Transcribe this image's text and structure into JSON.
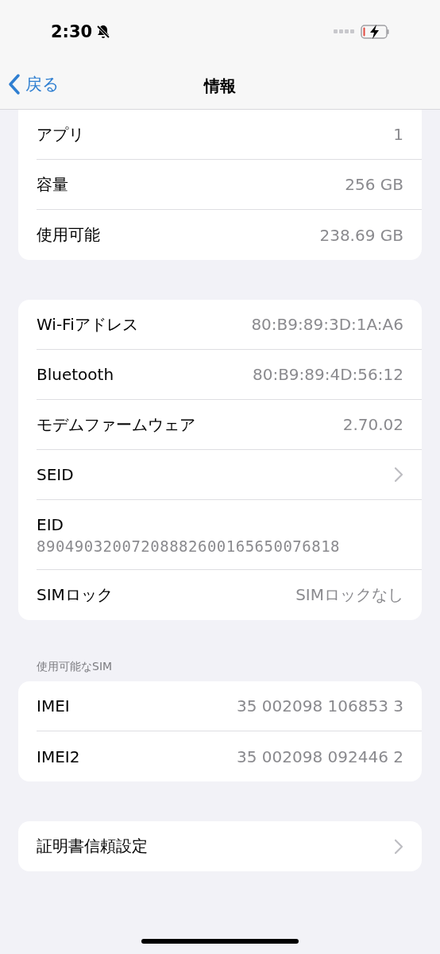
{
  "status_bar": {
    "time": "2:30",
    "silent": true,
    "charging": true
  },
  "nav": {
    "back": "戻る",
    "title": "情報"
  },
  "groups": [
    {
      "rows": [
        {
          "kind": "value",
          "label": "アプリ",
          "value": "1"
        },
        {
          "kind": "value",
          "label": "容量",
          "value": "256 GB"
        },
        {
          "kind": "value",
          "label": "使用可能",
          "value": "238.69 GB"
        }
      ]
    },
    {
      "rows": [
        {
          "kind": "value",
          "label": "Wi-Fiアドレス",
          "value": "80:B9:89:3D:1A:A6"
        },
        {
          "kind": "value",
          "label": "Bluetooth",
          "value": "80:B9:89:4D:56:12"
        },
        {
          "kind": "value",
          "label": "モデムファームウェア",
          "value": "2.70.02"
        },
        {
          "kind": "chevron",
          "label": "SEID"
        },
        {
          "kind": "stacked",
          "label": "EID",
          "value": "89049032007208882600165650076818"
        },
        {
          "kind": "value",
          "label": "SIMロック",
          "value": "SIMロックなし"
        }
      ]
    },
    {
      "header": "使用可能なSIM",
      "rows": [
        {
          "kind": "value",
          "label": "IMEI",
          "value": "35 002098 106853 3"
        },
        {
          "kind": "value",
          "label": "IMEI2",
          "value": "35 002098 092446 2"
        }
      ]
    },
    {
      "rows": [
        {
          "kind": "chevron",
          "label": "証明書信頼設定"
        }
      ]
    }
  ]
}
